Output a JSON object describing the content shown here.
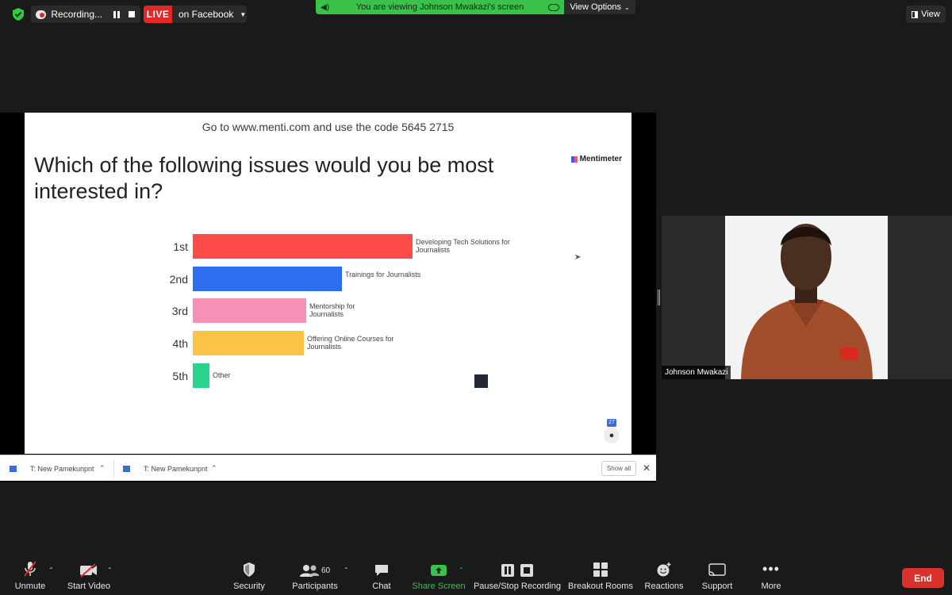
{
  "top_bar": {
    "recording_label": "Recording...",
    "live_badge": "LIVE",
    "live_target": "on Facebook",
    "viewing_banner": "You are viewing Johnson Mwakazi's screen",
    "view_options_label": "View Options",
    "view_label": "View"
  },
  "slide": {
    "instruction": "Go to www.menti.com and use the code 5645 2715",
    "brand": "Mentimeter",
    "question": "Which of the following issues would you be most interested in?",
    "audience_count": "27",
    "chart_data": {
      "type": "bar",
      "orientation": "horizontal",
      "categories": [
        "1st",
        "2nd",
        "3rd",
        "4th",
        "5th"
      ],
      "labels": [
        "Developing Tech Solutions for Journalists",
        "Trainings for Journalists",
        "Mentorship for Journalists",
        "Offering Online Courses for Journalists",
        "Other"
      ],
      "values": [
        100,
        67.7,
        51.6,
        50.4,
        7.5
      ],
      "colors": [
        "#ff4a4a",
        "#2e6df0",
        "#f690b6",
        "#fcc446",
        "#2bd48c"
      ],
      "grid": false,
      "legend": "none"
    }
  },
  "downloads": {
    "items": [
      {
        "label": "T: New Pamekunpnt"
      },
      {
        "label": "T: New Pamekunpnt"
      }
    ],
    "show_all": "Show all",
    "close": "✕"
  },
  "video": {
    "participant_name": "Johnson Mwakazi"
  },
  "toolbar": {
    "unmute": "Unmute",
    "start_video": "Start Video",
    "security": "Security",
    "participants": "Participants",
    "participants_count": "60",
    "chat": "Chat",
    "share_screen": "Share Screen",
    "pause_stop_recording": "Pause/Stop Recording",
    "breakout_rooms": "Breakout Rooms",
    "reactions": "Reactions",
    "support": "Support",
    "more": "More",
    "end": "End"
  },
  "colors": {
    "live_red": "#e02828",
    "banner_green": "#3ac14a",
    "share_green": "#3ac14a",
    "end_red": "#d8302b"
  }
}
